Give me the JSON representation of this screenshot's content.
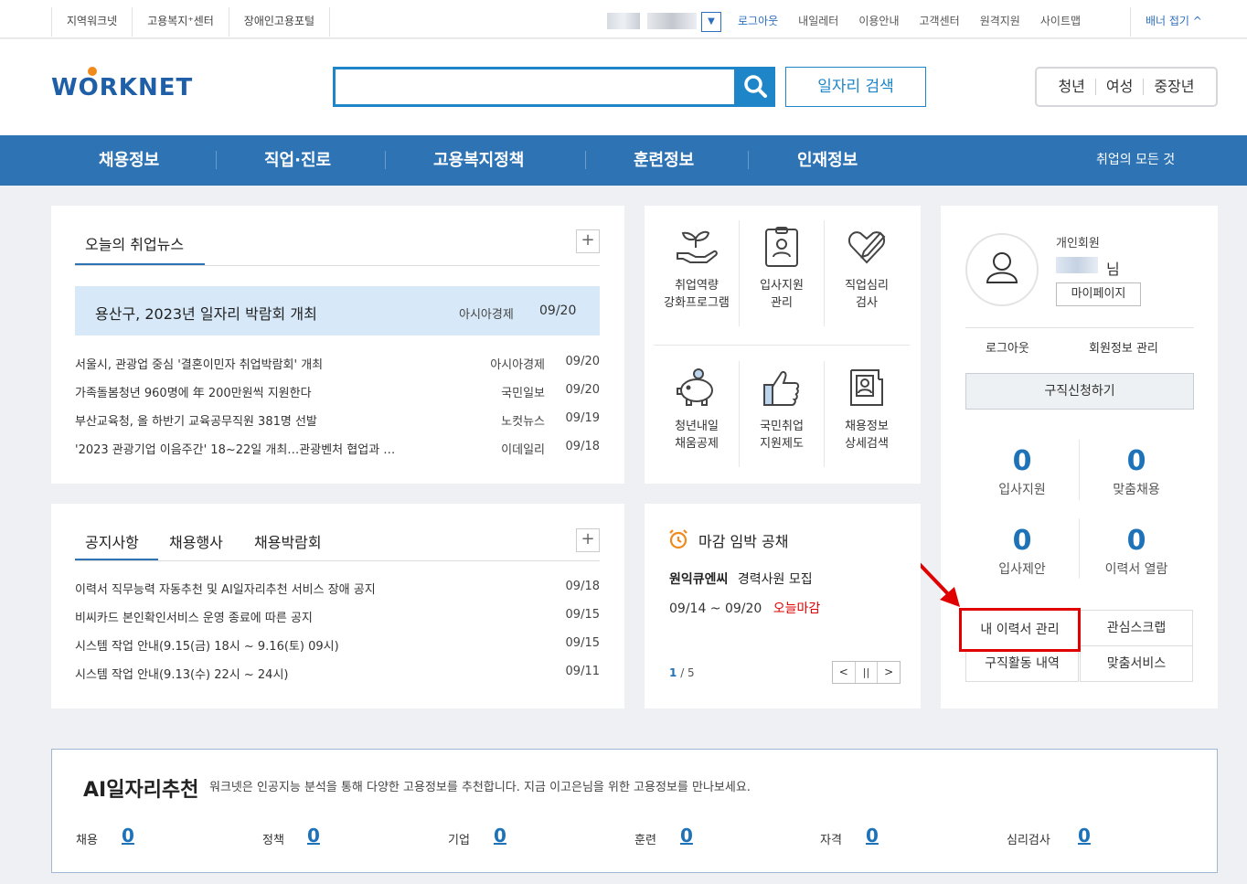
{
  "topbar": {
    "left_links": [
      "지역워크넷",
      "고용복지⁺센터",
      "장애인고용포털"
    ],
    "dropdown_icon": "chevron-down-icon",
    "right_links": [
      "로그아웃",
      "내일레터",
      "이용안내",
      "고객센터",
      "원격지원",
      "사이트맵"
    ],
    "banner_toggle": "배너 접기 ^"
  },
  "header": {
    "logo_text": "WORKNET",
    "search": {
      "value": "",
      "placeholder": ""
    },
    "search_icon": "search-icon",
    "job_search_label": "일자리 검색",
    "segments": [
      "청년",
      "여성",
      "중장년"
    ]
  },
  "gnb": {
    "items": [
      "채용정보",
      "직업·진로",
      "고용복지정책",
      "훈련정보",
      "인재정보"
    ],
    "all_link": "취업의 모든 것"
  },
  "news": {
    "title": "오늘의 취업뉴스",
    "highlight": {
      "title": "용산구, 2023년 일자리 박람회 개최",
      "source": "아시아경제",
      "date": "09/20"
    },
    "items": [
      {
        "title": "서울시, 관광업 중심 '결혼이민자 취업박람회' 개최",
        "source": "아시아경제",
        "date": "09/20"
      },
      {
        "title": "가족돌봄청년 960명에 年 200만원씩 지원한다",
        "source": "국민일보",
        "date": "09/20"
      },
      {
        "title": "부산교육청, 올 하반기 교육공무직원 381명 선발",
        "source": "노컷뉴스",
        "date": "09/19"
      },
      {
        "title": "'2023 관광기업 이음주간' 18~22일 개최…관광벤처 협업과 …",
        "source": "이데일리",
        "date": "09/18"
      }
    ]
  },
  "quick": {
    "items": [
      {
        "label1": "취업역량",
        "label2": "강화프로그램",
        "icon": "sprout-hand-icon"
      },
      {
        "label1": "입사지원",
        "label2": "관리",
        "icon": "id-clipboard-icon"
      },
      {
        "label1": "직업심리",
        "label2": "검사",
        "icon": "heart-pen-icon"
      },
      {
        "label1": "청년내일",
        "label2": "채움공제",
        "icon": "piggy-bank-icon"
      },
      {
        "label1": "국민취업",
        "label2": "지원제도",
        "icon": "thumbs-up-icon"
      },
      {
        "label1": "채용정보",
        "label2": "상세검색",
        "icon": "id-document-icon"
      }
    ]
  },
  "user": {
    "type": "개인회원",
    "suffix": "님",
    "mypage": "마이페이지",
    "logout": "로그아웃",
    "member_info": "회원정보 관리",
    "apply": "구직신청하기",
    "stats": [
      {
        "value": "0",
        "label": "입사지원"
      },
      {
        "value": "0",
        "label": "맞춤채용"
      },
      {
        "value": "0",
        "label": "입사제안"
      },
      {
        "value": "0",
        "label": "이력서 열람"
      }
    ],
    "buttons": [
      "내 이력서 관리",
      "관심스크랩",
      "구직활동 내역",
      "맞춤서비스"
    ]
  },
  "notices": {
    "tabs": [
      "공지사항",
      "채용행사",
      "채용박람회"
    ],
    "items": [
      {
        "title": "이력서 직무능력 자동추천 및 AI일자리추천 서비스 장애 공지",
        "date": "09/18"
      },
      {
        "title": "비씨카드 본인확인서비스 운영 종료에 따른 공지",
        "date": "09/15"
      },
      {
        "title": "시스템 작업 안내(9.15(금) 18시 ~ 9.16(토) 09시)",
        "date": "09/15"
      },
      {
        "title": "시스템 작업 안내(9.13(수) 22시 ~ 24시)",
        "date": "09/11"
      }
    ]
  },
  "deadline": {
    "title": "마감 임박 공채",
    "company": "원익큐엔씨",
    "position": "경력사원 모집",
    "period": "09/14 ~ 09/20",
    "status": "오늘마감",
    "page_current": "1",
    "page_total": "/ 5"
  },
  "ai": {
    "title": "AI일자리추천",
    "desc": "워크넷은 인공지능 분석을 통해 다양한 고용정보를 추천합니다. 지금 이고은님을 위한 고용정보를 만나보세요.",
    "cats": [
      {
        "label": "채용",
        "value": "0"
      },
      {
        "label": "정책",
        "value": "0"
      },
      {
        "label": "기업",
        "value": "0"
      },
      {
        "label": "훈련",
        "value": "0"
      },
      {
        "label": "자격",
        "value": "0"
      },
      {
        "label": "심리검사",
        "value": "0"
      }
    ]
  },
  "colors": {
    "primary": "#2e74b5",
    "accent": "#1e86c8",
    "highlight_red": "#e10000",
    "deadline_orange": "#f08a1c"
  }
}
